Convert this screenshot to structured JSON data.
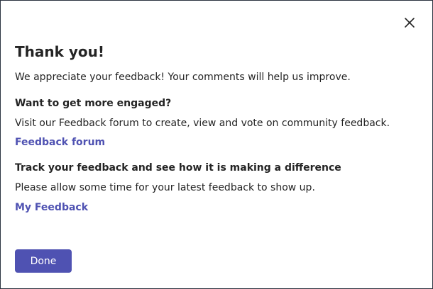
{
  "dialog": {
    "title": "Thank you!",
    "intro": "We appreciate your feedback! Your comments will help us improve.",
    "engage_heading": "Want to get more engaged?",
    "engage_text": "Visit our Feedback forum to create, view and vote on community feedback.",
    "forum_link": "Feedback forum",
    "track_heading": "Track your feedback and see how it is making a difference",
    "track_text": "Please allow some time for your latest feedback to show up.",
    "my_feedback_link": "My Feedback",
    "done_label": "Done",
    "close_icon": "close-icon"
  },
  "colors": {
    "accent": "#4f52b2",
    "text": "#242424",
    "border": "#2b3340"
  }
}
